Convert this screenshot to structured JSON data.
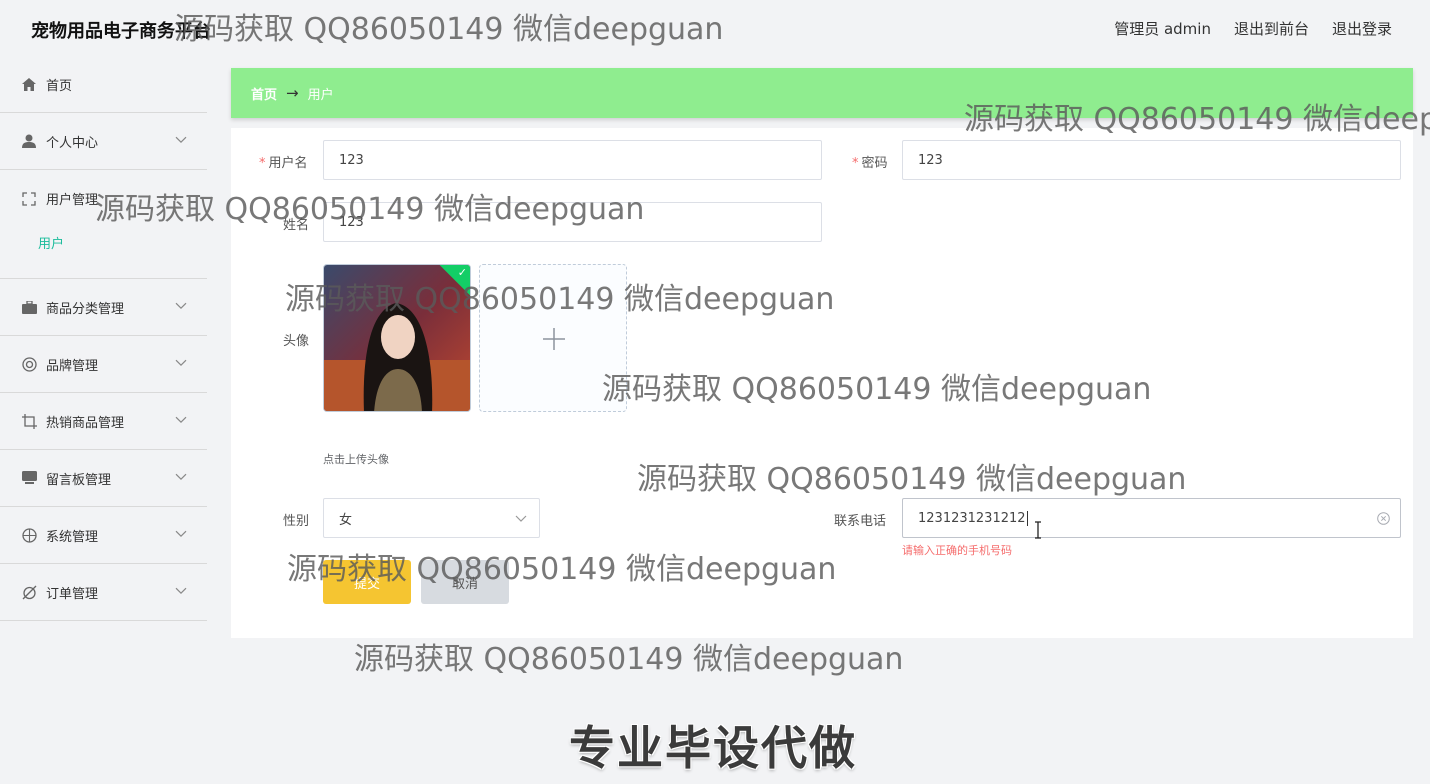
{
  "app": {
    "title": "宠物用品电子商务平台"
  },
  "header": {
    "admin_label": "管理员 admin",
    "to_front_label": "退出到前台",
    "logout_label": "退出登录"
  },
  "sidebar": {
    "items": [
      {
        "label": "首页",
        "icon": "home-icon"
      },
      {
        "label": "个人中心",
        "icon": "user-icon"
      },
      {
        "label": "用户管理",
        "icon": "fullscreen-icon",
        "children": [
          {
            "label": "用户"
          }
        ]
      },
      {
        "label": "商品分类管理",
        "icon": "briefcase-icon"
      },
      {
        "label": "品牌管理",
        "icon": "lifebuoy-icon"
      },
      {
        "label": "热销商品管理",
        "icon": "crop-icon"
      },
      {
        "label": "留言板管理",
        "icon": "chat-icon"
      },
      {
        "label": "系统管理",
        "icon": "basketball-icon"
      },
      {
        "label": "订单管理",
        "icon": "alarm-off-icon"
      }
    ]
  },
  "breadcrumb": {
    "home": "首页",
    "separator": "→",
    "current": "用户"
  },
  "form": {
    "username": {
      "label": "用户名",
      "required_mark": "*",
      "value": "123"
    },
    "password": {
      "label": "密码",
      "required_mark": "*",
      "value": "123"
    },
    "name": {
      "label": "姓名",
      "value": "123"
    },
    "avatar": {
      "label": "头像",
      "hint": "点击上传头像",
      "upload_icon": "plus-icon"
    },
    "gender": {
      "label": "性别",
      "value": "女"
    },
    "phone": {
      "label": "联系电话",
      "value": "1231231231212",
      "error": "请输入正确的手机号码"
    },
    "submit_label": "提交",
    "cancel_label": "取消"
  },
  "overlays": {
    "watermark_text": "源码获取 QQ86050149 微信deepguan",
    "banner_text": "专业毕设代做"
  },
  "colors": {
    "breadcrumb_bg": "#8fed8f",
    "accent": "#1bbc9b",
    "submit": "#f5c531",
    "error": "#f56c6c",
    "success_badge": "#13ce66"
  }
}
